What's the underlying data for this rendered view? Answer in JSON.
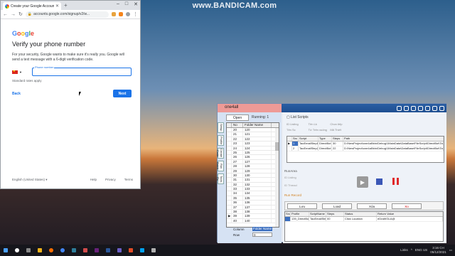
{
  "watermark": "www.BANDICAM.com",
  "chrome": {
    "tab_title": "Create your Google Account",
    "url": "accounts.google.com/signup/v2/w...",
    "google_page": {
      "logo": [
        "G",
        "o",
        "o",
        "g",
        "l",
        "e"
      ],
      "title": "Verify your phone number",
      "description": "For your security, Google wants to make sure it's really you. Google will send a text message with a 6-digit verification code.",
      "phone_label": "Phone number",
      "phone_value": "",
      "rates_note": "Standard rates apply",
      "back_label": "Back",
      "next_label": "Next",
      "language": "English (United States)",
      "footer_links": [
        "Help",
        "Privacy",
        "Terms"
      ]
    }
  },
  "app": {
    "title": "one4all",
    "open_label": "Open",
    "running_label": "Running: 1",
    "vertical_tabs": [
      "Setup",
      "Profile",
      "Create Code",
      "Run Batch",
      "Tools Rx"
    ],
    "grid": {
      "headers": [
        "",
        "No",
        "Folder Name"
      ],
      "rows": [
        [
          "",
          "20",
          "120"
        ],
        [
          "",
          "21",
          "121"
        ],
        [
          "",
          "22",
          "122"
        ],
        [
          "",
          "23",
          "123"
        ],
        [
          "",
          "24",
          "124"
        ],
        [
          "",
          "25",
          "125"
        ],
        [
          "",
          "26",
          "126"
        ],
        [
          "",
          "27",
          "127"
        ],
        [
          "",
          "28",
          "128"
        ],
        [
          "",
          "29",
          "129"
        ],
        [
          "",
          "30",
          "130"
        ],
        [
          "",
          "31",
          "131"
        ],
        [
          "",
          "32",
          "132"
        ],
        [
          "",
          "33",
          "133"
        ],
        [
          "",
          "34",
          "134"
        ],
        [
          "",
          "35",
          "135"
        ],
        [
          "",
          "36",
          "136"
        ],
        [
          "",
          "37",
          "137"
        ],
        [
          "",
          "38",
          "138"
        ],
        [
          "▶",
          "39",
          "139"
        ],
        [
          "",
          "40",
          "140"
        ]
      ],
      "column_label": "Column",
      "column_value": "Folder Name",
      "row_label": "Row",
      "row_value": "0"
    },
    "list_scripts_tab": "List Scripts",
    "options": [
      "ID Listing",
      "Tên Lk",
      "Chon tiếp",
      "Tên Sc",
      "Từ Trên xuống",
      "Mã Thiết"
    ],
    "scripts_table": {
      "headers": [
        "",
        "Src",
        "Script",
        "Type",
        "Steps",
        "Path"
      ],
      "rows": [
        [
          "▶",
          "1",
          "TaoEmailStep1",
          "DirectBot",
          "30",
          "D:\\NewProject\\one4all\\bin\\Debug\\1MainData\\DataBase\\FileScript\\DirectBot\\TaoEmailStep1"
        ],
        [
          "",
          "2",
          "TaoEmailStep2",
          "DirectBot",
          "22",
          "D:\\NewProject\\one4all\\bin\\Debug\\1MainData\\DataBase\\FileScript\\DirectBot\\TaoEmailStep2"
        ]
      ]
    },
    "run_area_label": "RunArea",
    "run_fields": [
      "ID Listing",
      "ID Thread"
    ],
    "run_record_label": "Run Record",
    "action_buttons": [
      "Lưu",
      "Load",
      "Xóa",
      "Xo"
    ],
    "steps_table": {
      "headers": [
        "Src",
        "Profile",
        "ScriptName",
        "Steps",
        "Status",
        "Return Value"
      ],
      "rows": [
        [
          "",
          "139_DirectBot",
          "TaoEmailStep1",
          "00",
          "Click Location",
          "eDraWGLA@"
        ]
      ]
    }
  },
  "taskbar": {
    "tray_lang": "ENG",
    "tray_region": "US",
    "time": "3:16 CH",
    "date": "05/12/2021",
    "links_label": "Links"
  }
}
